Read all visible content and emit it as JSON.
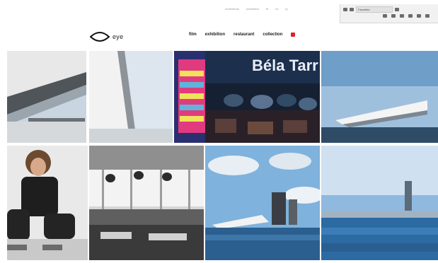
{
  "header": {
    "logo_text": "eye",
    "utility_links": [
      "nederlands",
      "newsletter",
      "fb",
      "tw",
      "ig"
    ],
    "nav": [
      {
        "label": "film"
      },
      {
        "label": "exhibition"
      },
      {
        "label": "restaurant"
      },
      {
        "label": "collection"
      }
    ]
  },
  "browser": {
    "tab_title": "Favorites"
  },
  "poster": {
    "text_1": "Béla Tarr"
  },
  "colors": {
    "accent": "#e0222c",
    "sky": "#b9d3ea",
    "water": "#3a77b9"
  },
  "icons": {
    "logo": "eye-logo-icon",
    "external": "external-link-icon"
  }
}
